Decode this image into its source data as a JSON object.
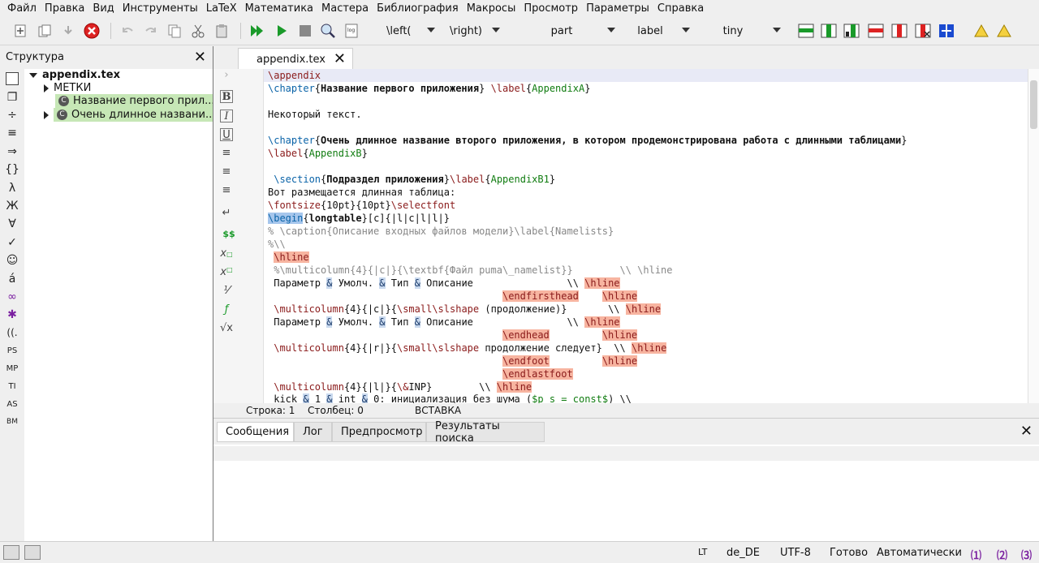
{
  "menu": [
    "Файл",
    "Правка",
    "Вид",
    "Инструменты",
    "LaTeX",
    "Математика",
    "Мастера",
    "Библиография",
    "Макросы",
    "Просмотр",
    "Параметры",
    "Справка"
  ],
  "toolbar": {
    "left_combo": "\\left(",
    "right_combo": "\\right)",
    "structure_combo": "part",
    "label_combo": "label",
    "size_combo": "tiny"
  },
  "structure": {
    "title": "Структура",
    "root": "appendix.tex",
    "labels": "МЕТКИ",
    "items": [
      "Название первого прил...",
      "Очень длинное названи..."
    ]
  },
  "tab": {
    "filename": "appendix.tex"
  },
  "code_lines": [
    "\\appendix",
    "\\chapter{Название первого приложения} \\label{AppendixA}",
    "",
    "Некоторый текст.",
    "",
    "\\chapter{Очень длинное название второго приложения, в котором продемонстрирована работа с длинными таблицами}",
    "\\label{AppendixB}",
    "",
    " \\section{Подраздел приложения}\\label{AppendixB1}",
    "Вот размещается длинная таблица:",
    "\\fontsize{10pt}{10pt}\\selectfont",
    "\\begin{longtable}[c]{|l|c|l|l|}",
    "% \\caption{Описание входных файлов модели}\\label{Namelists}",
    "%\\\\",
    " \\hline",
    " %\\multicolumn{4}{|c|}{\\textbf{Файл puma\\_namelist}}        \\\\ \\hline",
    " Параметр & Умолч. & Тип & Описание                \\\\ \\hline",
    "                                        \\endfirsthead    \\hline",
    " \\multicolumn{4}{|c|}{\\small\\slshape (продолжение)}        \\\\ \\hline",
    " Параметр & Умолч. & Тип & Описание                \\\\ \\hline",
    "                                        \\endhead         \\hline",
    " \\multicolumn{4}{|r|}{\\small\\slshape продолжение следует}  \\\\ \\hline",
    "                                        \\endfoot         \\hline",
    "                                        \\endlastfoot",
    " \\multicolumn{4}{|l|}{\\&INP}        \\\\ \\hline",
    " kick & 1 & int & 0: инициализация без шума ($p_s = const$) \\\\"
  ],
  "editor_status": {
    "line": "Строка: 1",
    "column": "Столбец: 0",
    "mode": "ВСТАВКА"
  },
  "bottom_tabs": [
    "Сообщения",
    "Лог",
    "Предпросмотр",
    "Результаты поиска"
  ],
  "statusbar": {
    "lang": "de_DE",
    "encoding": "UTF-8",
    "ready": "Готово",
    "auto": "Автоматически"
  },
  "colors": {
    "highlight_green": "#c6e7b6",
    "env_orange": "#f7b4a0",
    "current_line": "#e8eaf6"
  }
}
